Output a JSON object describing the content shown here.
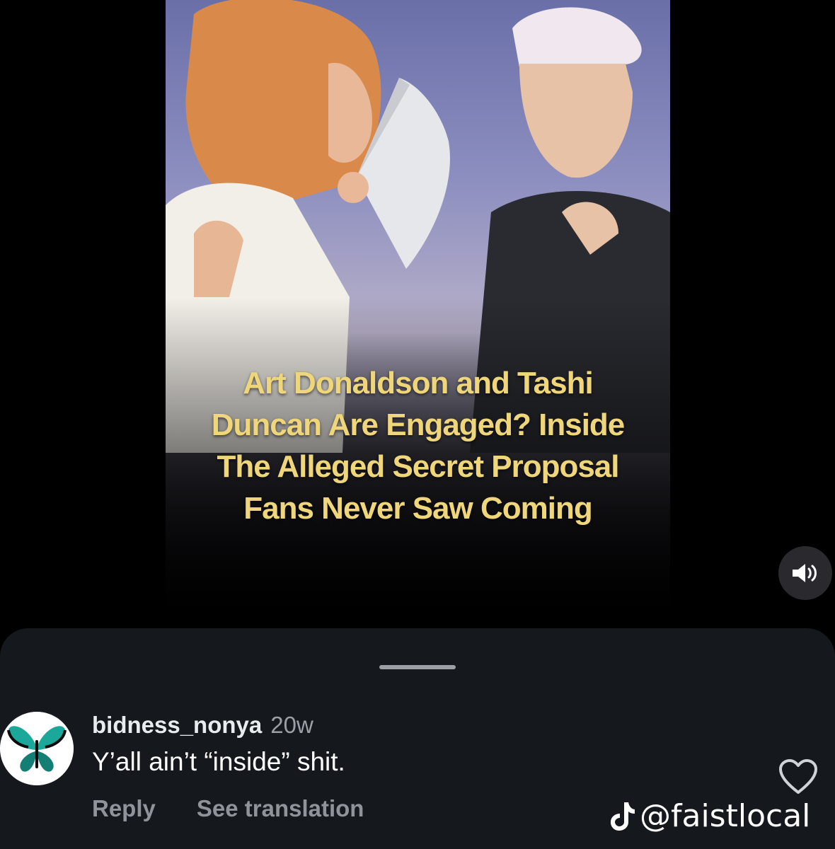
{
  "post": {
    "headline_lines": [
      "Art Donaldson and Tashi",
      "Duncan Are Engaged? Inside",
      "The Alleged Secret Proposal",
      "Fans Never Saw Coming"
    ],
    "mute_icon": "speaker-icon"
  },
  "comment": {
    "username": "bidness_nonya",
    "age": "20w",
    "text": "Y’all ain’t “inside” shit.",
    "reply_label": "Reply",
    "translate_label": "See translation",
    "avatar_icon": "butterfly-icon",
    "like_icon": "heart-icon"
  },
  "watermark": {
    "handle": "@faistlocal",
    "icon": "tiktok-icon"
  },
  "colors": {
    "headline": "#efd67a",
    "sheet": "#15181c"
  }
}
